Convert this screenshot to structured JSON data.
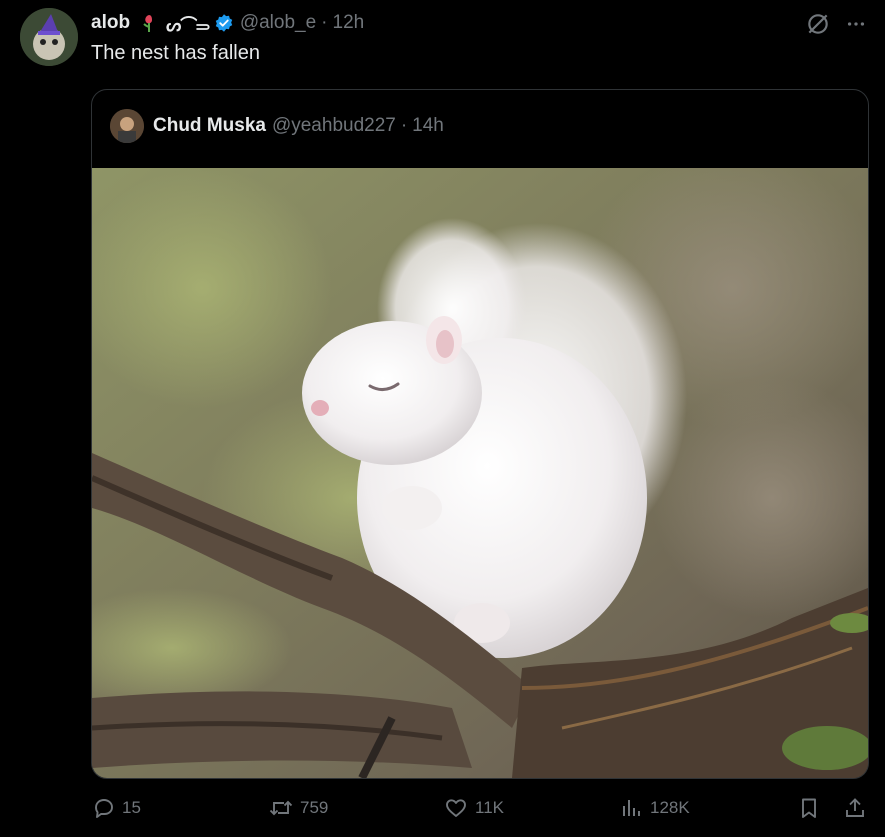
{
  "tweet": {
    "author_name": "alob",
    "author_emojis": "ᔕ⌒⥰",
    "handle": "@alob_e",
    "separator": "·",
    "time": "12h",
    "text": "The nest has fallen"
  },
  "quote": {
    "author_name": "Chud Muska",
    "handle": "@yeahbud227",
    "separator": "·",
    "time": "14h"
  },
  "actions": {
    "replies": "15",
    "reposts": "759",
    "likes": "11K",
    "views": "128K"
  },
  "colors": {
    "background": "#000000",
    "text": "#e7e9ea",
    "muted": "#71767b",
    "border": "#2f3336",
    "verified": "#1d9bf0"
  }
}
